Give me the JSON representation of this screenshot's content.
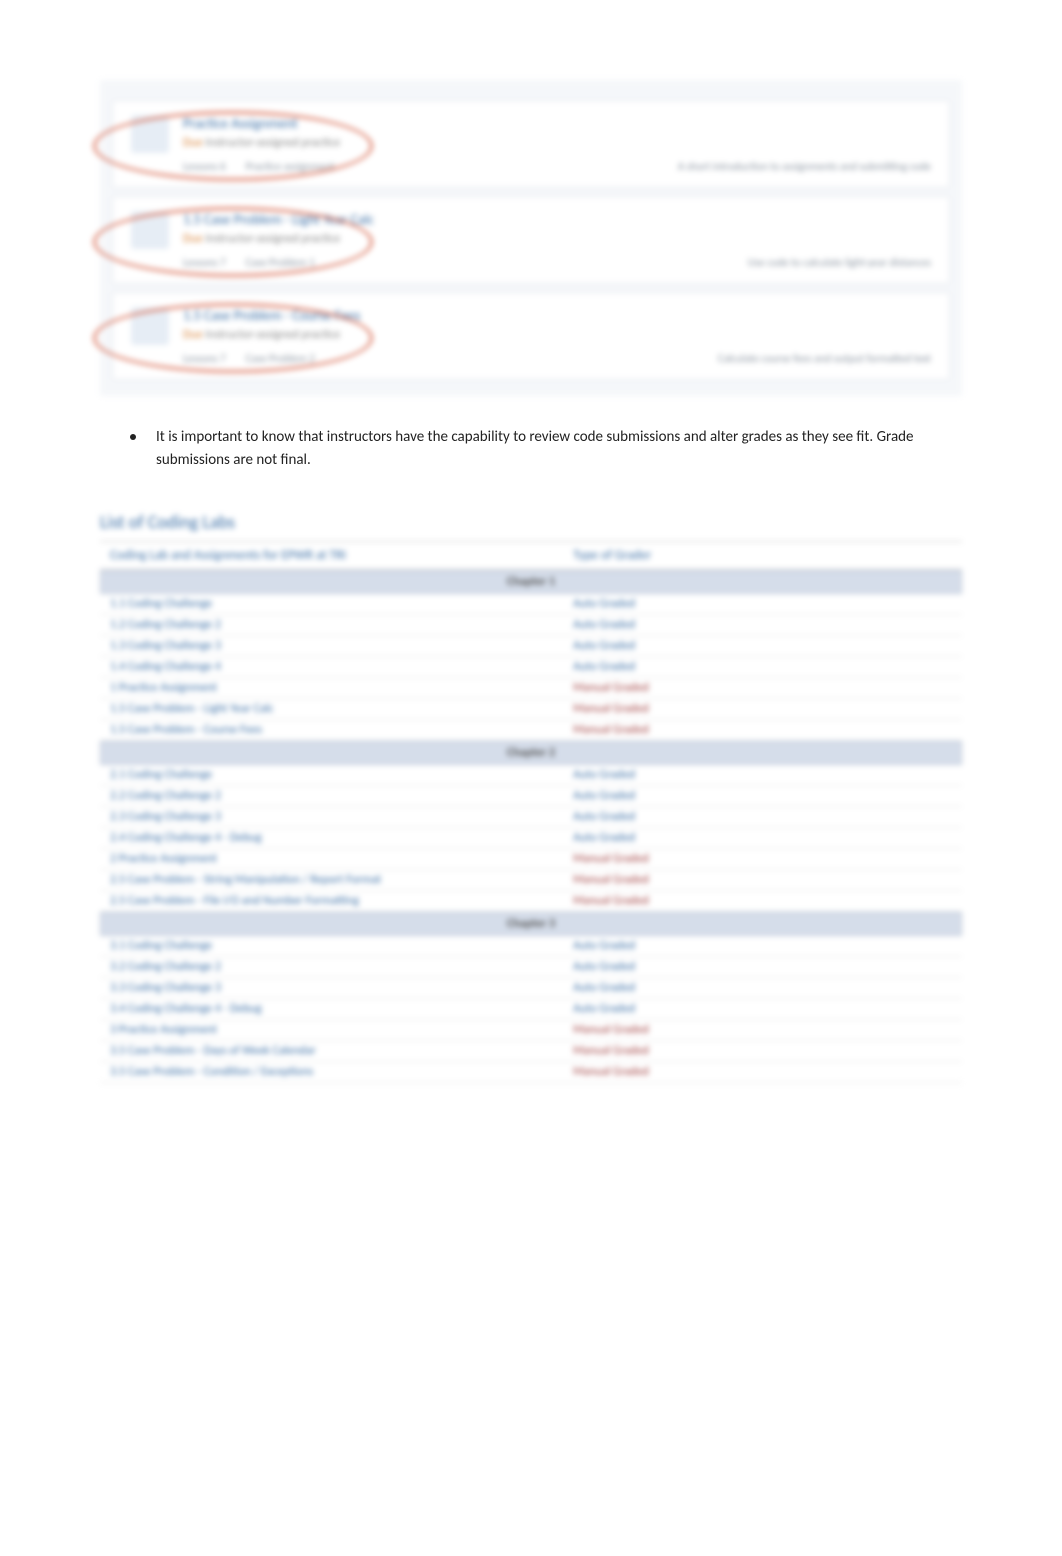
{
  "assignment_cards": [
    {
      "title": "Practice Assignment",
      "sub_prefix": "Due",
      "sub_text": "Instructor-assigned practice",
      "footer_left": "Lessons 6",
      "footer_mid": "Practice assignment",
      "footer_right": "A short introduction to assignments and submitting code"
    },
    {
      "title": "1.5 Case Problem - Light Year Calc",
      "sub_prefix": "Due",
      "sub_text": "Instructor-assigned practice",
      "footer_left": "Lessons 7",
      "footer_mid": "Case Problem 1",
      "footer_right": "Use code to calculate light-year distances"
    },
    {
      "title": "1.5 Case Problem - Course Fees",
      "sub_prefix": "Due",
      "sub_text": "Instructor-assigned practice",
      "footer_left": "Lessons 7",
      "footer_mid": "Case Problem 2",
      "footer_right": "Calculate course fees and output formatted text"
    }
  ],
  "bullet": {
    "text": "It is important to know that instructors have the capability to review code submissions and alter grades as they see fit. Grade submissions are not final."
  },
  "table": {
    "title": "List of Coding Labs",
    "header_left": "Coding Lab and Assignments for EPWR at TRI",
    "header_right": "Type of Grader",
    "groups": [
      {
        "label": "Chapter 1",
        "rows": [
          {
            "left": "1.1 Coding Challenge",
            "right": "Auto Graded",
            "style": "auto"
          },
          {
            "left": "1.2 Coding Challenge 2",
            "right": "Auto Graded",
            "style": "auto"
          },
          {
            "left": "1.3 Coding Challenge 3",
            "right": "Auto Graded",
            "style": "auto"
          },
          {
            "left": "1.4 Coding Challenge 4",
            "right": "Auto Graded",
            "style": "auto"
          },
          {
            "left": "1 Practice Assignment",
            "right": "Manual Graded",
            "style": "manual"
          },
          {
            "left": "1.5 Case Problem - Light Year Calc",
            "right": "Manual Graded",
            "style": "manual"
          },
          {
            "left": "1.5 Case Problem - Course Fees",
            "right": "Manual Graded",
            "style": "manual"
          }
        ]
      },
      {
        "label": "Chapter 2",
        "rows": [
          {
            "left": "2.1 Coding Challenge",
            "right": "Auto Graded",
            "style": "auto"
          },
          {
            "left": "2.2 Coding Challenge 2",
            "right": "Auto Graded",
            "style": "auto"
          },
          {
            "left": "2.3 Coding Challenge 3",
            "right": "Auto Graded",
            "style": "auto"
          },
          {
            "left": "2.4 Coding Challenge 4 - Debug",
            "right": "Auto Graded",
            "style": "auto"
          },
          {
            "left": "2 Practice Assignment",
            "right": "Manual Graded",
            "style": "manual"
          },
          {
            "left": "2.5 Case Problem - String Manipulation / Report Format",
            "right": "Manual Graded",
            "style": "manual"
          },
          {
            "left": "2.5 Case Problem - File I/O and Number Formatting",
            "right": "Manual Graded",
            "style": "manual"
          }
        ]
      },
      {
        "label": "Chapter 3",
        "rows": [
          {
            "left": "3.1 Coding Challenge",
            "right": "Auto Graded",
            "style": "auto"
          },
          {
            "left": "3.2 Coding Challenge 2",
            "right": "Auto Graded",
            "style": "auto"
          },
          {
            "left": "3.3 Coding Challenge 3",
            "right": "Auto Graded",
            "style": "auto"
          },
          {
            "left": "3.4 Coding Challenge 4 - Debug",
            "right": "Auto Graded",
            "style": "auto"
          },
          {
            "left": "3 Practice Assignment",
            "right": "Manual Graded",
            "style": "manual"
          },
          {
            "left": "3.5 Case Problem - Days of Week Calendar",
            "right": "Manual Graded",
            "style": "manual"
          },
          {
            "left": "3.5 Case Problem - Condition / Exceptions",
            "right": "Manual Graded",
            "style": "manual"
          }
        ]
      }
    ]
  }
}
